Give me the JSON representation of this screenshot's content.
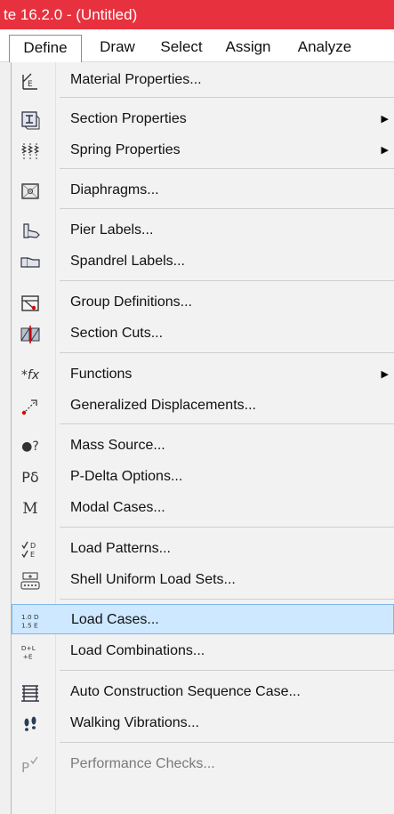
{
  "window": {
    "title": "te 16.2.0 - (Untitled)",
    "title_color": "#e8313e"
  },
  "menubar": {
    "tabs": [
      "Define",
      "Draw",
      "Select",
      "Assign",
      "Analyze"
    ],
    "active": "Define"
  },
  "menu": {
    "items": [
      {
        "label": "Material Properties...",
        "icon": "material-properties-icon",
        "submenu": false
      },
      {
        "label": "Section Properties",
        "icon": "section-properties-icon",
        "submenu": true
      },
      {
        "label": "Spring Properties",
        "icon": "spring-properties-icon",
        "submenu": true
      },
      {
        "label": "Diaphragms...",
        "icon": "diaphragm-icon",
        "submenu": false
      },
      {
        "label": "Pier Labels...",
        "icon": "pier-labels-icon",
        "submenu": false
      },
      {
        "label": "Spandrel Labels...",
        "icon": "spandrel-labels-icon",
        "submenu": false
      },
      {
        "label": "Group Definitions...",
        "icon": "group-definitions-icon",
        "submenu": false
      },
      {
        "label": "Section Cuts...",
        "icon": "section-cuts-icon",
        "submenu": false
      },
      {
        "label": "Functions",
        "icon": "functions-icon",
        "icon_text": "*fx",
        "submenu": true
      },
      {
        "label": "Generalized Displacements...",
        "icon": "generalized-displacements-icon",
        "submenu": false
      },
      {
        "label": "Mass Source...",
        "icon": "mass-source-icon",
        "icon_text": "●?",
        "submenu": false
      },
      {
        "label": "P-Delta Options...",
        "icon": "p-delta-icon",
        "icon_text": "Pδ",
        "submenu": false
      },
      {
        "label": "Modal Cases...",
        "icon": "modal-cases-icon",
        "icon_text": "M",
        "submenu": false
      },
      {
        "label": "Load Patterns...",
        "icon": "load-patterns-icon",
        "icon_text": "D E",
        "submenu": false
      },
      {
        "label": "Shell Uniform Load Sets...",
        "icon": "shell-uniform-load-sets-icon",
        "submenu": false
      },
      {
        "label": "Load Cases...",
        "icon": "load-cases-icon",
        "icon_text": "1.0 D 1.5 E",
        "submenu": false,
        "highlighted": true
      },
      {
        "label": "Load Combinations...",
        "icon": "load-combinations-icon",
        "icon_text": "D+L +E",
        "submenu": false
      },
      {
        "label": "Auto Construction Sequence Case...",
        "icon": "auto-construction-sequence-icon",
        "submenu": false
      },
      {
        "label": "Walking Vibrations...",
        "icon": "walking-vibrations-icon",
        "submenu": false
      },
      {
        "label": "Performance Checks...",
        "icon": "performance-checks-icon",
        "submenu": false,
        "disabled": true
      }
    ]
  },
  "colors": {
    "highlight_bg": "#cde8ff",
    "highlight_border": "#7fb7e6"
  }
}
